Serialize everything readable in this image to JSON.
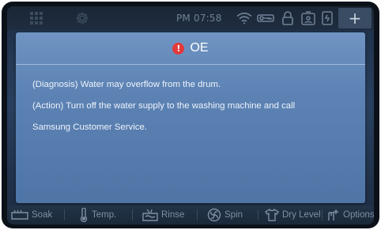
{
  "status_bar": {
    "time": "PM 07:58",
    "icons": [
      "apps-grid-icon",
      "settings-gear-icon",
      "wifi-icon",
      "key-icon",
      "door-lock-icon",
      "child-lock-icon",
      "smart-control-icon"
    ],
    "add_label": "+"
  },
  "dialog": {
    "error_code": "OE",
    "alert_icon": "!",
    "diagnosis": "(Diagnosis) Water may overflow from the drum.",
    "action_line1": "(Action) Turn off the water supply to the washing machine and call",
    "action_line2": "Samsung Customer Service."
  },
  "bottom_bar": {
    "soak": "Soak",
    "temp": "Temp.",
    "rinse": "Rinse",
    "spin": "Spin",
    "dry_level": "Dry Level",
    "options": "Options"
  },
  "colors": {
    "dialog_bg": "#5d83b5",
    "alert_red": "#e23a3a",
    "statusbar_text": "#6f8096",
    "bottombar_text": "#7f8fa4"
  }
}
